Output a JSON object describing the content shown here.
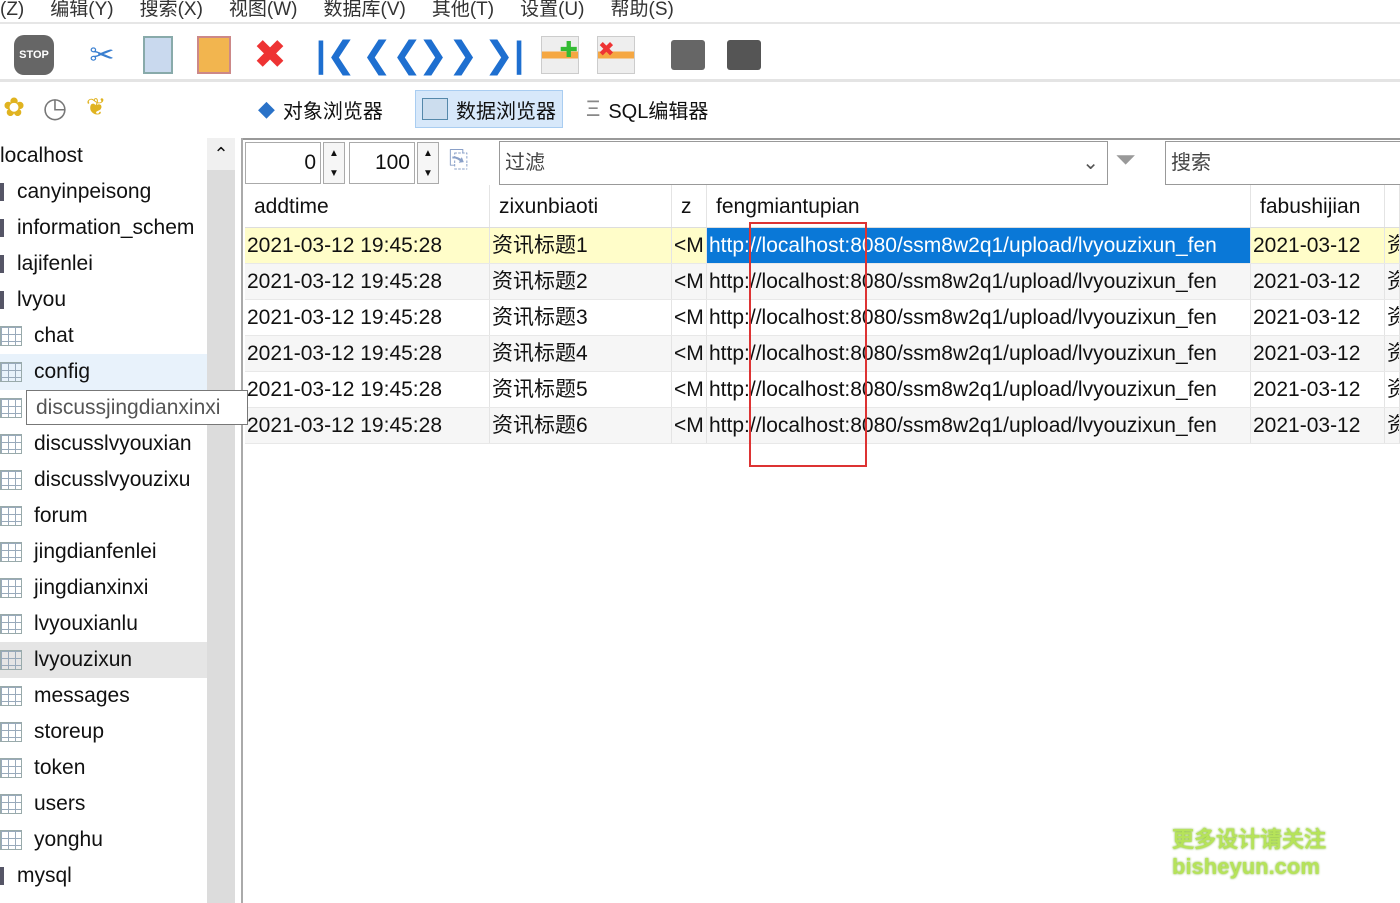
{
  "menu": [
    "(Z)",
    "编辑(Y)",
    "搜索(X)",
    "视图(W)",
    "数据库(V)",
    "其他(T)",
    "设置(U)",
    "帮助(S)"
  ],
  "toolbar": {
    "stop_label": "STOP"
  },
  "tabs": [
    {
      "label": "对象浏览器"
    },
    {
      "label": "数据浏览器",
      "active": true
    },
    {
      "label": "SQL编辑器"
    }
  ],
  "tree": {
    "root": "localhost",
    "items": [
      {
        "label": "canyinpeisong",
        "type": "db"
      },
      {
        "label": "information_schem",
        "type": "db"
      },
      {
        "label": "lajifenlei",
        "type": "db"
      },
      {
        "label": "lvyou",
        "type": "db"
      },
      {
        "label": "chat",
        "type": "table"
      },
      {
        "label": "config",
        "type": "table"
      },
      {
        "label": "discussjingdianxinxi",
        "type": "table"
      },
      {
        "label": "discusslvyouxian",
        "type": "table"
      },
      {
        "label": "discusslvyouzixu",
        "type": "table"
      },
      {
        "label": "forum",
        "type": "table"
      },
      {
        "label": "jingdianfenlei",
        "type": "table"
      },
      {
        "label": "jingdianxinxi",
        "type": "table"
      },
      {
        "label": "lvyouxianlu",
        "type": "table"
      },
      {
        "label": "lvyouzixun",
        "type": "table",
        "selected": true
      },
      {
        "label": "messages",
        "type": "table"
      },
      {
        "label": "storeup",
        "type": "table"
      },
      {
        "label": "token",
        "type": "table"
      },
      {
        "label": "users",
        "type": "table"
      },
      {
        "label": "yonghu",
        "type": "table"
      },
      {
        "label": "mysql",
        "type": "db"
      }
    ],
    "tooltip": "discussjingdianxinxi"
  },
  "pager": {
    "offset": "0",
    "limit": "100",
    "filter_placeholder": "过滤",
    "search_placeholder": "搜索"
  },
  "grid": {
    "columns": [
      "addtime",
      "zixunbiaoti",
      "z",
      "fengmiantupian",
      "fabushijian",
      ""
    ],
    "rows": [
      [
        "2021-03-12 19:45:28",
        "资讯标题1",
        "<M",
        "http://localhost:8080/ssm8w2q1/upload/lvyouzixun_fen",
        "2021-03-12",
        "资"
      ],
      [
        "2021-03-12 19:45:28",
        "资讯标题2",
        "<M",
        "http://localhost:8080/ssm8w2q1/upload/lvyouzixun_fen",
        "2021-03-12",
        "资"
      ],
      [
        "2021-03-12 19:45:28",
        "资讯标题3",
        "<M",
        "http://localhost:8080/ssm8w2q1/upload/lvyouzixun_fen",
        "2021-03-12",
        "资"
      ],
      [
        "2021-03-12 19:45:28",
        "资讯标题4",
        "<M",
        "http://localhost:8080/ssm8w2q1/upload/lvyouzixun_fen",
        "2021-03-12",
        "资"
      ],
      [
        "2021-03-12 19:45:28",
        "资讯标题5",
        "<M",
        "http://localhost:8080/ssm8w2q1/upload/lvyouzixun_fen",
        "2021-03-12",
        "资"
      ],
      [
        "2021-03-12 19:45:28",
        "资讯标题6",
        "<M",
        "http://localhost:8080/ssm8w2q1/upload/lvyouzixun_fen",
        "2021-03-12",
        "资"
      ]
    ]
  },
  "watermark": {
    "line1": "更多设计请关注",
    "line2": "bisheyun.com"
  }
}
